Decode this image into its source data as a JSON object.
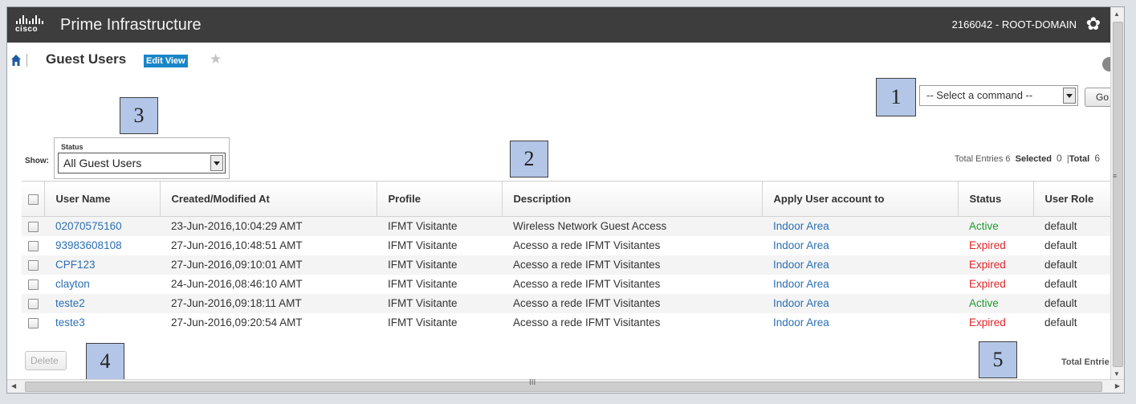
{
  "header": {
    "logo_text": "cisco",
    "app_name": "Prime Infrastructure",
    "domain": "2166042 - ROOT-DOMAIN"
  },
  "page": {
    "title": "Guest Users",
    "edit_view": "Edit View"
  },
  "command": {
    "placeholder": "-- Select a command --",
    "go_label": "Go"
  },
  "filter": {
    "show_label": "Show:",
    "status_label": "Status",
    "status_value": "All Guest Users"
  },
  "summary": {
    "total_entries_label": "Total Entries",
    "total_entries": "6",
    "selected_label": "Selected",
    "selected": "0",
    "total_label": "Total",
    "total": "6"
  },
  "table": {
    "columns": [
      "User Name",
      "Created/Modified At",
      "Profile",
      "Description",
      "Apply User account to",
      "Status",
      "User Role"
    ],
    "rows": [
      {
        "user": "02070575160",
        "created": "23-Jun-2016,10:04:29 AMT",
        "profile": "IFMT Visitante",
        "description": "Wireless Network Guest Access",
        "apply": "Indoor Area",
        "status": "Active",
        "role": "default"
      },
      {
        "user": "93983608108",
        "created": "27-Jun-2016,10:48:51 AMT",
        "profile": "IFMT Visitante",
        "description": "Acesso a rede IFMT Visitantes",
        "apply": "Indoor Area",
        "status": "Expired",
        "role": "default"
      },
      {
        "user": "CPF123",
        "created": "27-Jun-2016,09:10:01 AMT",
        "profile": "IFMT Visitante",
        "description": "Acesso a rede IFMT Visitantes",
        "apply": "Indoor Area",
        "status": "Expired",
        "role": "default"
      },
      {
        "user": "clayton",
        "created": "24-Jun-2016,08:46:10 AMT",
        "profile": "IFMT Visitante",
        "description": "Acesso a rede IFMT Visitantes",
        "apply": "Indoor Area",
        "status": "Expired",
        "role": "default"
      },
      {
        "user": "teste2",
        "created": "27-Jun-2016,09:18:11 AMT",
        "profile": "IFMT Visitante",
        "description": "Acesso a rede IFMT Visitantes",
        "apply": "Indoor Area",
        "status": "Active",
        "role": "default"
      },
      {
        "user": "teste3",
        "created": "27-Jun-2016,09:20:54 AMT",
        "profile": "IFMT Visitante",
        "description": "Acesso a rede IFMT Visitantes",
        "apply": "Indoor Area",
        "status": "Expired",
        "role": "default"
      }
    ]
  },
  "footer": {
    "delete_label": "Delete",
    "total_entries_cut": "Total Entrie"
  },
  "annotations": [
    "1",
    "2",
    "3",
    "4",
    "5"
  ],
  "colors": {
    "header_bg": "#3d3d3d",
    "link": "#2b6fb3",
    "active": "#1e9b2d",
    "expired": "#e0262a",
    "annotation_box": "#b3c6e7"
  },
  "icons": [
    "home-icon",
    "star-icon",
    "gear-icon",
    "dropdown-arrow-icon"
  ]
}
